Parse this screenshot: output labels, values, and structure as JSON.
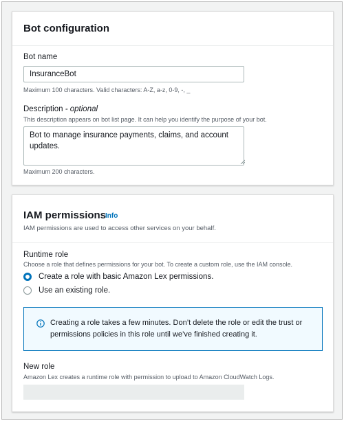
{
  "bot_configuration": {
    "title": "Bot configuration",
    "bot_name": {
      "label": "Bot name",
      "value": "InsuranceBot",
      "constraint": "Maximum 100 characters. Valid characters: A-Z, a-z, 0-9, -, _"
    },
    "description": {
      "label": "Description",
      "optional_suffix": "- optional",
      "hint": "This description appears on bot list page. It can help you identify the purpose of your bot.",
      "value": "Bot to manage insurance payments, claims, and account updates.",
      "constraint": "Maximum 200 characters."
    }
  },
  "iam_permissions": {
    "title": "IAM permissions",
    "info_link": "Info",
    "description": "IAM permissions are used to access other services on your behalf.",
    "runtime_role": {
      "label": "Runtime role",
      "hint": "Choose a role that defines permissions for your bot. To create a custom role, use the IAM console.",
      "options": [
        {
          "label": "Create a role with basic Amazon Lex permissions.",
          "selected": true
        },
        {
          "label": "Use an existing role.",
          "selected": false
        }
      ]
    },
    "alert": {
      "icon": "info-circle-icon",
      "text": "Creating a role takes a few minutes. Don’t delete the role or edit the trust or permissions policies in this role until we’ve finished creating it."
    },
    "new_role": {
      "label": "New role",
      "hint": "Amazon Lex creates a runtime role with permission to upload to Amazon CloudWatch Logs."
    }
  },
  "colors": {
    "accent": "#0073bb",
    "alert_background": "#f1faff",
    "text": "#16191f",
    "secondary_text": "#545b64"
  }
}
